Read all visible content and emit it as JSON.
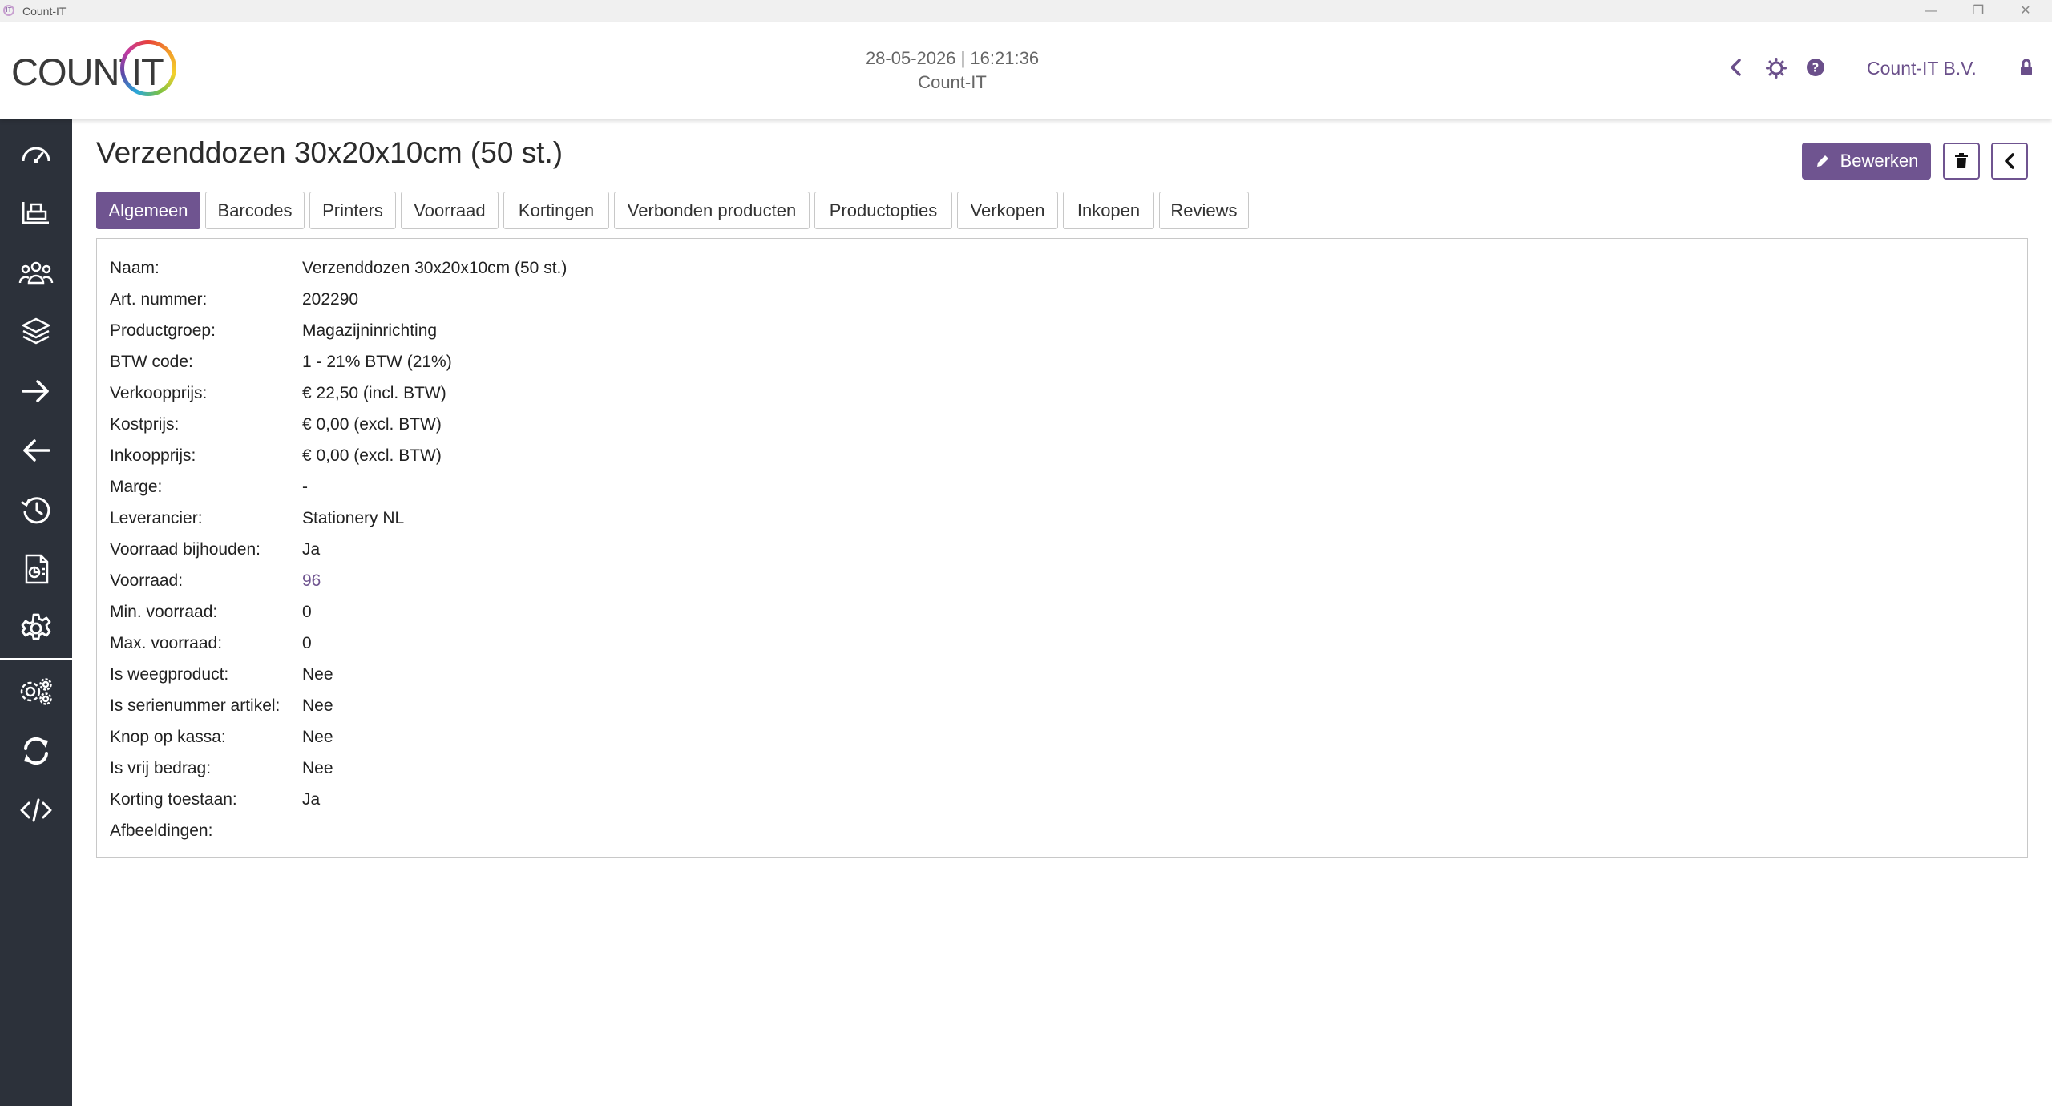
{
  "window": {
    "title": "Count-IT",
    "app_icon_text": "IT",
    "minimize": "—",
    "restore": "❐",
    "close": "✕"
  },
  "header": {
    "logo_text": "COUNT",
    "logo_it": "IT",
    "datetime": "28-05-2026 | 16:21:36",
    "store": "Count-IT",
    "company": "Count-IT B.V."
  },
  "sidebar": {
    "items": [
      {
        "icon": "dashboard-icon"
      },
      {
        "icon": "register-icon"
      },
      {
        "icon": "customers-icon"
      },
      {
        "icon": "products-icon"
      },
      {
        "icon": "arrow-right-icon"
      },
      {
        "icon": "arrow-left-icon"
      },
      {
        "icon": "history-icon"
      },
      {
        "icon": "reports-icon"
      },
      {
        "icon": "settings-icon"
      },
      {
        "icon": "advanced-settings-icon"
      },
      {
        "icon": "sync-icon"
      },
      {
        "icon": "code-icon"
      }
    ]
  },
  "page": {
    "title": "Verzenddozen 30x20x10cm (50 st.)",
    "edit_label": "Bewerken"
  },
  "tabs": [
    "Algemeen",
    "Barcodes",
    "Printers",
    "Voorraad",
    "Kortingen",
    "Verbonden producten",
    "Productopties",
    "Verkopen",
    "Inkopen",
    "Reviews"
  ],
  "details": [
    {
      "label": "Naam:",
      "value": "Verzenddozen 30x20x10cm (50 st.)"
    },
    {
      "label": "Art. nummer:",
      "value": "202290"
    },
    {
      "label": "Productgroep:",
      "value": "Magazijninrichting"
    },
    {
      "label": "BTW code:",
      "value": "1 - 21% BTW (21%)"
    },
    {
      "label": "Verkoopprijs:",
      "value": "€ 22,50 (incl. BTW)"
    },
    {
      "label": "Kostprijs:",
      "value": "€ 0,00 (excl. BTW)"
    },
    {
      "label": "Inkoopprijs:",
      "value": "€ 0,00 (excl. BTW)"
    },
    {
      "label": "Marge:",
      "value": "-"
    },
    {
      "label": "Leverancier:",
      "value": "Stationery NL"
    },
    {
      "label": "Voorraad bijhouden:",
      "value": "Ja"
    },
    {
      "label": "Voorraad:",
      "value": "96"
    },
    {
      "label": "Min. voorraad:",
      "value": "0"
    },
    {
      "label": "Max. voorraad:",
      "value": "0"
    },
    {
      "label": "Is weegproduct:",
      "value": "Nee"
    },
    {
      "label": "Is serienummer artikel:",
      "value": "Nee"
    },
    {
      "label": "Knop op kassa:",
      "value": "Nee"
    },
    {
      "label": "Is vrij bedrag:",
      "value": "Nee"
    },
    {
      "label": "Korting toestaan:",
      "value": "Ja"
    },
    {
      "label": "Afbeeldingen:",
      "value": ""
    }
  ],
  "colors": {
    "accent": "#6f5490",
    "sidebar": "#2c313a"
  }
}
